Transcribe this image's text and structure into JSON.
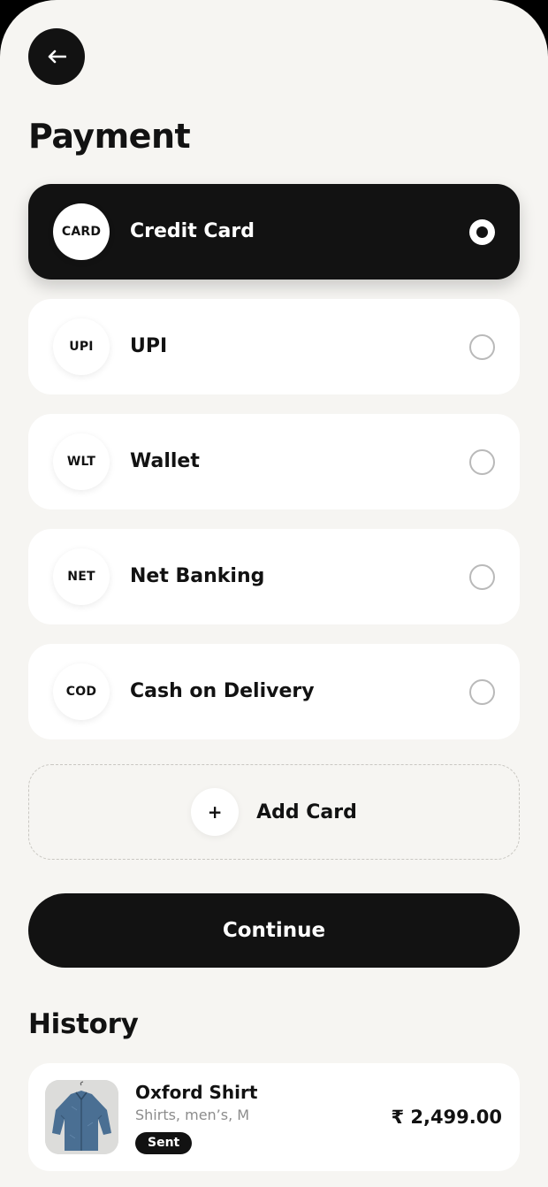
{
  "page": {
    "title": "Payment"
  },
  "payment_methods": [
    {
      "badge": "CARD",
      "label": "Credit Card",
      "selected": true
    },
    {
      "badge": "UPI",
      "label": "UPI",
      "selected": false
    },
    {
      "badge": "WLT",
      "label": "Wallet",
      "selected": false
    },
    {
      "badge": "NET",
      "label": "Net Banking",
      "selected": false
    },
    {
      "badge": "COD",
      "label": "Cash on Delivery",
      "selected": false
    }
  ],
  "add_card": {
    "icon": "+",
    "label": "Add Card"
  },
  "continue_label": "Continue",
  "history": {
    "title": "History",
    "items": [
      {
        "name": "Oxford Shirt",
        "meta": "Shirts, men’s, M",
        "status": "Sent",
        "price": "₹ 2,499.00"
      }
    ]
  },
  "colors": {
    "background": "#f6f5f2",
    "primary": "#121212",
    "card": "#ffffff",
    "muted_text": "#8c8c8c"
  }
}
